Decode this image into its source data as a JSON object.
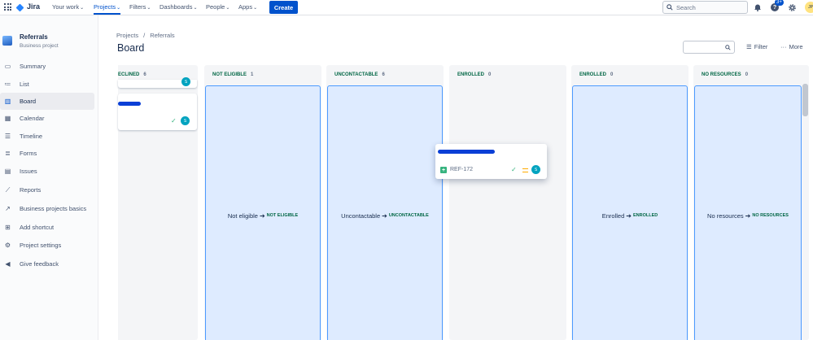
{
  "nav": {
    "logo": "Jira",
    "items": [
      "Your work",
      "Projects",
      "Filters",
      "Dashboards",
      "People",
      "Apps"
    ],
    "create": "Create",
    "search_placeholder": "Search",
    "notification_badge": "3+",
    "avatar": "JP"
  },
  "sidebar": {
    "project_name": "Referrals",
    "project_type": "Business project",
    "items": [
      "Summary",
      "List",
      "Board",
      "Calendar",
      "Timeline",
      "Forms",
      "Issues",
      "Reports",
      "Business projects basics",
      "Add shortcut",
      "Project settings",
      "Give feedback"
    ],
    "active": "Board"
  },
  "header": {
    "breadcrumb": [
      "Projects",
      "/",
      "Referrals"
    ],
    "title": "Board",
    "filter": "Filter",
    "more": "More"
  },
  "columns": [
    {
      "title": "ECLINED",
      "count": "6"
    },
    {
      "title": "NOT ELIGIBLE",
      "count": "1",
      "drop_label": "Not eligible",
      "drop_status": "NOT ELIGIBLE"
    },
    {
      "title": "UNCONTACTABLE",
      "count": "6",
      "drop_label": "Uncontactable",
      "drop_status": "UNCONTACTABLE"
    },
    {
      "title": "ENROLLED",
      "count": "0"
    },
    {
      "title": "ENROLLED",
      "count": "0",
      "drop_label": "Enrolled",
      "drop_status": "ENROLLED"
    },
    {
      "title": "NO RESOURCES",
      "count": "0",
      "drop_label": "No resources",
      "drop_status": "NO RESOURCES"
    }
  ],
  "dragged_card": {
    "key": "REF-172",
    "avatar": "S"
  },
  "cards": [
    {
      "avatar": "S"
    },
    {
      "avatar": "S"
    }
  ],
  "colors": {
    "accent": "#0052cc",
    "drop_zone": "#deebff",
    "drop_border": "#4c9aff",
    "status_green": "#006644"
  }
}
